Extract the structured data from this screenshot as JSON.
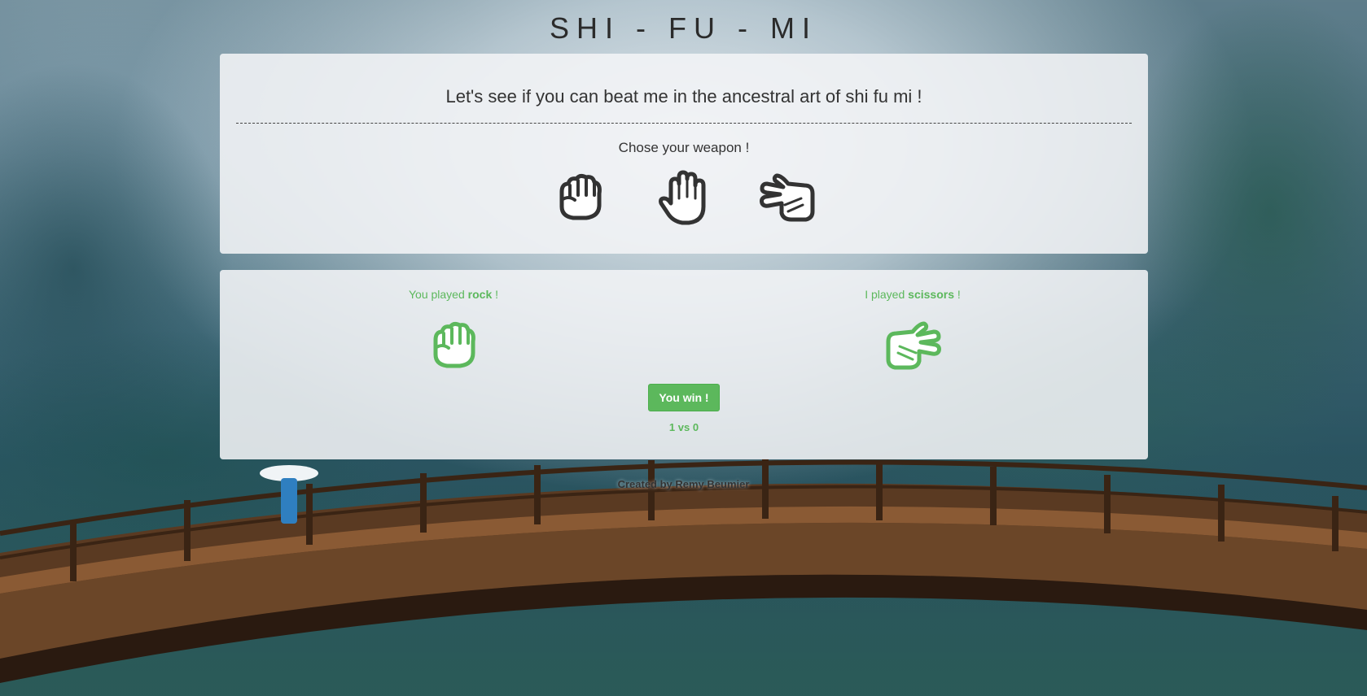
{
  "title": "SHI - FU - MI",
  "intro": "Let's see if you can beat me in the ancestral art of shi fu mi !",
  "choose_label": "Chose your weapon !",
  "weapons": [
    {
      "name": "rock",
      "icon": "fist-icon"
    },
    {
      "name": "paper",
      "icon": "open-hand-icon"
    },
    {
      "name": "scissors",
      "icon": "scissors-hand-icon"
    }
  ],
  "result": {
    "you_prefix": "You played",
    "you_choice": "rock",
    "you_suffix": "!",
    "me_prefix": "I played",
    "me_choice": "scissors",
    "me_suffix": "!",
    "outcome": "You win !",
    "score": "1 vs 0"
  },
  "footer": "Created by Remy Beumier",
  "colors": {
    "accent_green": "#5cb85c",
    "icon_dark": "#333333",
    "panel_bg": "#f2f4f6"
  }
}
